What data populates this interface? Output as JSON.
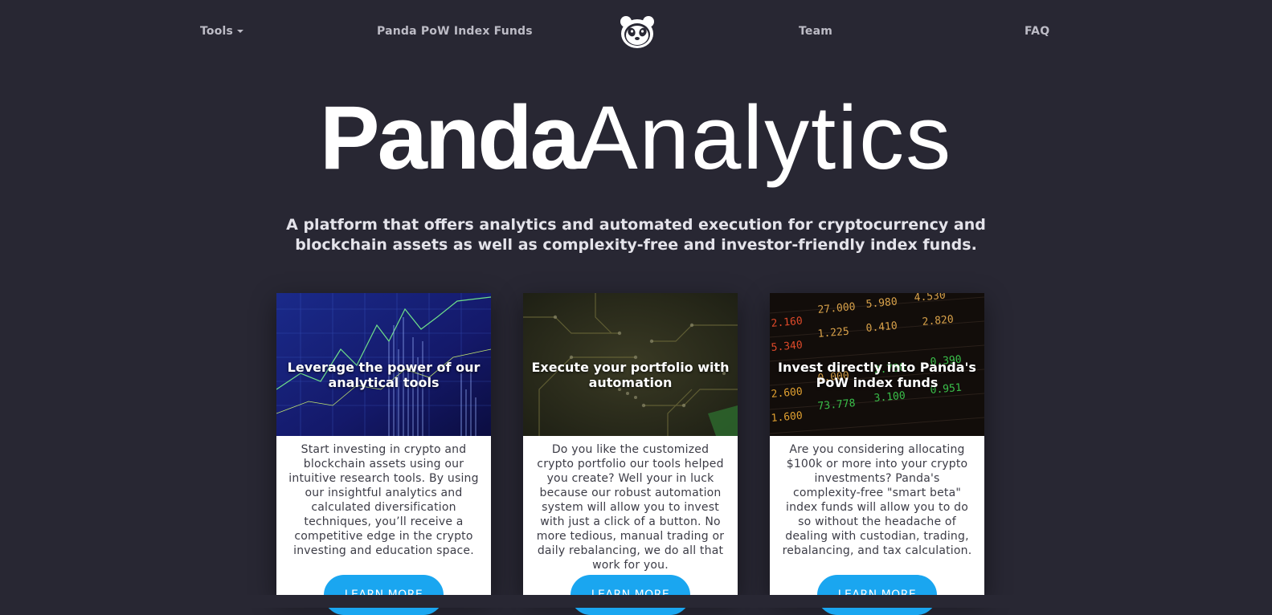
{
  "nav": {
    "tools": "Tools",
    "index_funds": "Panda PoW Index Funds",
    "team": "Team",
    "faq": "FAQ",
    "logo_icon": "panda-face-icon"
  },
  "hero": {
    "title_bold": "Panda",
    "title_light": "Analytics",
    "subtitle": "A platform that offers analytics and automated execution for cryptocurrency and blockchain assets as well as complexity-free and investor-friendly index funds."
  },
  "cards": [
    {
      "heading": "Leverage the power of our analytical tools",
      "body": "Start investing in crypto and blockchain assets using our intuitive research tools. By using our insightful analytics and calculated diversification techniques, you’ll receive a competitive edge in the crypto investing and education space.",
      "button": "LEARN MORE"
    },
    {
      "heading": "Execute your portfolio with automation",
      "body": "Do you like the customized crypto portfolio our tools helped you create? Well your in luck because our robust automation system will allow you to invest with just a click of a button. No more tedious, manual trading or daily rebalancing, we do all that work for you.",
      "button": "LEARN MORE"
    },
    {
      "heading": "Invest directly into Panda's PoW index funds",
      "body": "Are you considering allocating $100k or more into your crypto investments? Panda's complexity-free \"smart beta\" index funds will allow you to do so without the headache of dealing with custodian, trading, rebalancing, and tax calculation.",
      "button": "LEARN MORE"
    }
  ],
  "colors": {
    "background": "#282733",
    "button": "#1aa6f0",
    "nav_text": "#bdbcc6"
  }
}
